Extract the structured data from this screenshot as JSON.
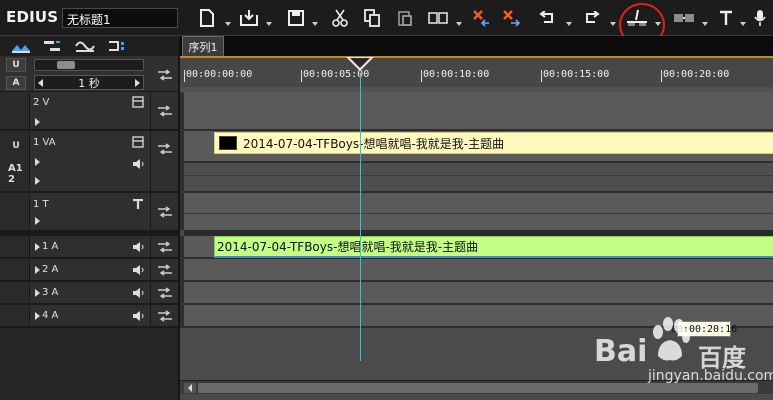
{
  "app": {
    "name": "EDIUS",
    "project_name": "无标题1"
  },
  "toolbar": {
    "icons": [
      "new-project-icon",
      "open-icon",
      "save-icon",
      "cut-icon",
      "copy-icon",
      "paste-icon",
      "insert-mode-icon",
      "delete-icon",
      "ripple-delete-icon",
      "undo-icon",
      "redo-icon",
      "split-clip-icon",
      "transition-icon",
      "title-icon",
      "microphone-icon"
    ],
    "highlight_color": "#e02020"
  },
  "left_panel": {
    "sync_lock": "U",
    "audio_lock": "A",
    "zoom_label": "1 秒",
    "tracks": [
      {
        "name": "2 V",
        "type": "video"
      },
      {
        "name": "1 VA",
        "type": "video-audio",
        "side_label": "A1 2"
      },
      {
        "name": "1 T",
        "type": "title"
      },
      {
        "name": "1 A",
        "type": "audio"
      },
      {
        "name": "2 A",
        "type": "audio"
      },
      {
        "name": "3 A",
        "type": "audio"
      },
      {
        "name": "4 A",
        "type": "audio"
      }
    ]
  },
  "timeline": {
    "sequence_tab": "序列1",
    "ruler_labels": [
      "00:00:00:00",
      "00:00:05:00",
      "00:00:10:00",
      "00:00:15:00",
      "00:00:20:00"
    ],
    "clips": {
      "video_clip": "2014-07-04-TFBoys-想唱就唱-我就是我-主题曲",
      "audio_clip": "2014-07-04-TFBoys-想唱就唱-我就是我-主题曲"
    },
    "tooltip_time": "00:00:20:16",
    "colors": {
      "video_clip": "#fff9bf",
      "audio_clip": "#c3ff86",
      "playhead": "#34c4cc",
      "ruler_accent": "#c58a1e"
    }
  },
  "watermark": {
    "logo_text_left": "Bai",
    "logo_text_right": "百度",
    "url": "jingyan.baidu.com"
  }
}
